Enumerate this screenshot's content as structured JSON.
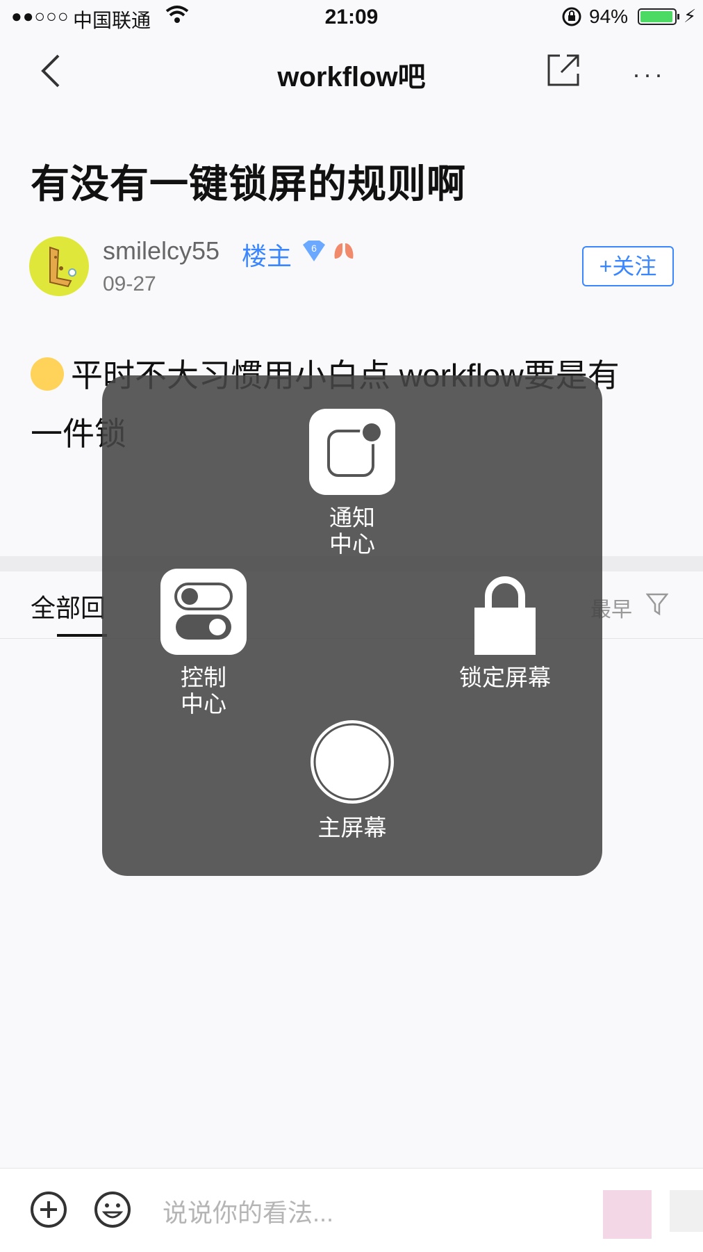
{
  "status_bar": {
    "signal": "●●○○○",
    "carrier": "中国联通",
    "time": "21:09",
    "battery_percent": "94%",
    "battery_level": 0.94,
    "battery_color": "#4cd964"
  },
  "nav": {
    "title": "workflow吧",
    "back_icon": "chevron-left-icon",
    "share_icon": "share-icon",
    "more_icon": "more-icon",
    "more_glyph": "···"
  },
  "post": {
    "title": "有没有一键锁屏的规则啊",
    "author": "smilelcy55",
    "role": "楼主",
    "level": "6",
    "date": "09-27",
    "follow_label": "+关注",
    "body_line1": "平时不大习惯用小白点 workflow要是有",
    "body_line2": "一件锁"
  },
  "tabs": {
    "all_replies": "全部回",
    "sort_label": "最早"
  },
  "assistive_touch": {
    "notification_center": [
      "通知",
      "中心"
    ],
    "control_center": [
      "控制",
      "中心"
    ],
    "lock_screen": "锁定屏幕",
    "home": "主屏幕"
  },
  "bottom_bar": {
    "comment_placeholder": "说说你的看法...",
    "add_icon": "plus-circle-icon",
    "emoji_icon": "smile-icon"
  },
  "colors": {
    "accent": "#3a86ff",
    "overlay": "#464646",
    "avatar_bg": "#dfe83a"
  }
}
